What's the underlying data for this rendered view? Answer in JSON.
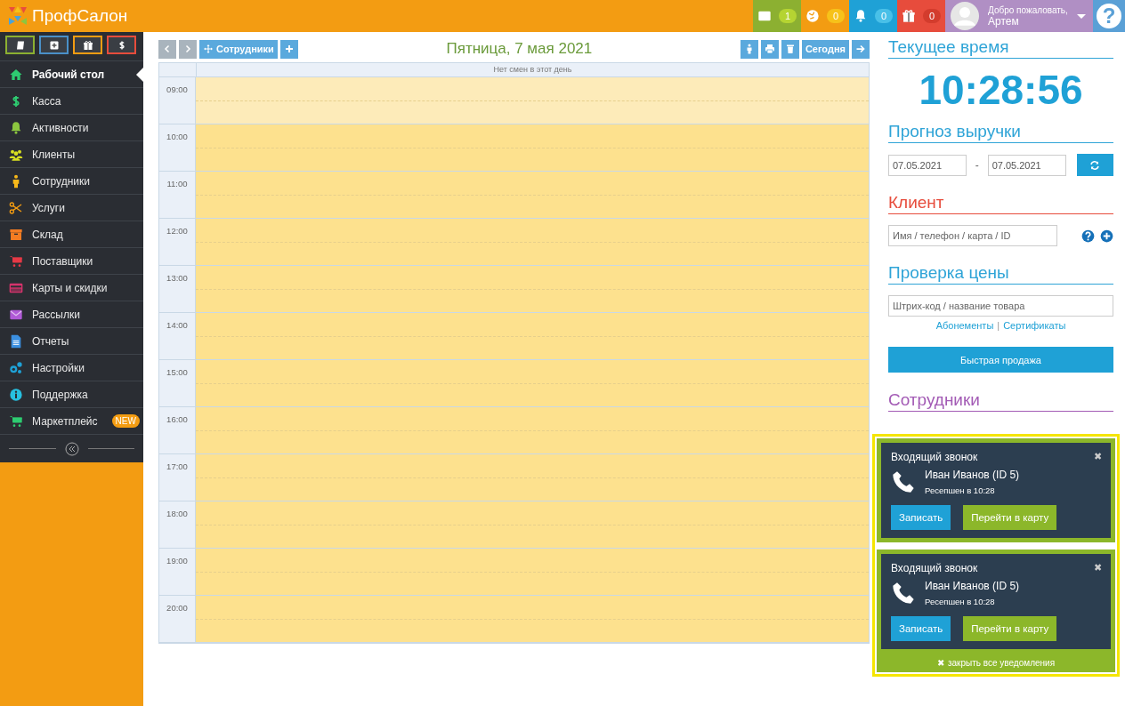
{
  "app": {
    "logo": "ПрофСалон"
  },
  "top_counters": [
    {
      "count": "1",
      "color": "#8cb031"
    },
    {
      "count": "0",
      "color": "#f39c12"
    },
    {
      "count": "0",
      "color": "#1fa1d6"
    },
    {
      "count": "0",
      "color": "#e74c3c"
    }
  ],
  "user": {
    "greeting": "Добро пожаловать,",
    "name": "Артем"
  },
  "help": {
    "label": "?"
  },
  "quick_buttons": [
    {
      "color": "#8cb031"
    },
    {
      "color": "#4a90c8"
    },
    {
      "color": "#f39c12"
    },
    {
      "color": "#e74c3c"
    }
  ],
  "sidebar": {
    "items": [
      {
        "label": "Рабочий стол",
        "color": "#2ecc71",
        "selected": true
      },
      {
        "label": "Касса",
        "color": "#2ecc71",
        "selected": false
      },
      {
        "label": "Активности",
        "color": "#8cc63f",
        "selected": false
      },
      {
        "label": "Клиенты",
        "color": "#d9e021",
        "selected": false
      },
      {
        "label": "Сотрудники",
        "color": "#f7b81a",
        "selected": false
      },
      {
        "label": "Услуги",
        "color": "#f39c12",
        "selected": false
      },
      {
        "label": "Склад",
        "color": "#f57c22",
        "selected": false
      },
      {
        "label": "Поставщики",
        "color": "#e63946",
        "selected": false
      },
      {
        "label": "Карты и скидки",
        "color": "#d6336c",
        "selected": false
      },
      {
        "label": "Рассылки",
        "color": "#b05ad6",
        "selected": false
      },
      {
        "label": "Отчеты",
        "color": "#3b8fe0",
        "selected": false
      },
      {
        "label": "Настройки",
        "color": "#1fa1d6",
        "selected": false
      },
      {
        "label": "Поддержка",
        "color": "#27c0e0",
        "selected": false
      },
      {
        "label": "Маркетплейс",
        "color": "#2ecc71",
        "selected": false,
        "badge": "NEW"
      }
    ]
  },
  "toolbar": {
    "left": [
      {
        "kind": "prev"
      },
      {
        "kind": "next"
      },
      {
        "kind": "staff",
        "label": "Сотрудники"
      },
      {
        "kind": "add"
      }
    ],
    "date_title": "Пятница, 7 мая 2021",
    "right": [
      {
        "kind": "person"
      },
      {
        "kind": "print"
      },
      {
        "kind": "trash"
      },
      {
        "kind": "today",
        "label": "Сегодня"
      },
      {
        "kind": "forward"
      }
    ]
  },
  "calendar": {
    "header": "Нет смен в этот день",
    "hours": [
      {
        "time": "09:00",
        "off_hours": true
      },
      {
        "time": "10:00",
        "off_hours": false
      },
      {
        "time": "11:00",
        "off_hours": false
      },
      {
        "time": "12:00",
        "off_hours": false
      },
      {
        "time": "13:00",
        "off_hours": false
      },
      {
        "time": "14:00",
        "off_hours": false
      },
      {
        "time": "15:00",
        "off_hours": false
      },
      {
        "time": "16:00",
        "off_hours": false
      },
      {
        "time": "17:00",
        "off_hours": false
      },
      {
        "time": "18:00",
        "off_hours": false
      },
      {
        "time": "19:00",
        "off_hours": false
      },
      {
        "time": "20:00",
        "off_hours": false
      }
    ]
  },
  "right_panel": {
    "clock": {
      "heading": "Текущее время",
      "color": "#2fa4d7",
      "time": "10:28:56"
    },
    "forecast": {
      "heading": "Прогноз выручки",
      "color": "#2fa4d7",
      "date_from": "07.05.2021",
      "separator": "-",
      "date_to": "07.05.2021"
    },
    "client": {
      "heading": "Клиент",
      "color": "#e74c3c",
      "placeholder": "Имя / телефон / карта / ID"
    },
    "price_check": {
      "heading": "Проверка цены",
      "color": "#2fa4d7",
      "placeholder": "Штрих-код / название товара",
      "links": [
        "Абонементы",
        "Сертификаты"
      ],
      "link_separator": "|"
    },
    "quick_sale": {
      "label": "Быстрая продажа"
    },
    "staff": {
      "heading": "Сотрудники",
      "color": "#a35bb5"
    }
  },
  "notifications": {
    "items": [
      {
        "title": "Входящий звонок",
        "close": "✖",
        "caller": "Иван Иванов (ID 5)",
        "detail": "Ресепшен в 10:28",
        "actions": [
          "Записать",
          "Перейти в карту"
        ]
      },
      {
        "title": "Входящий звонок",
        "close": "✖",
        "caller": "Иван Иванов (ID 5)",
        "detail": "Ресепшен в 10:28",
        "actions": [
          "Записать",
          "Перейти в карту"
        ]
      }
    ],
    "close_all": {
      "icon": "✖",
      "label": "закрыть все уведомления"
    }
  }
}
